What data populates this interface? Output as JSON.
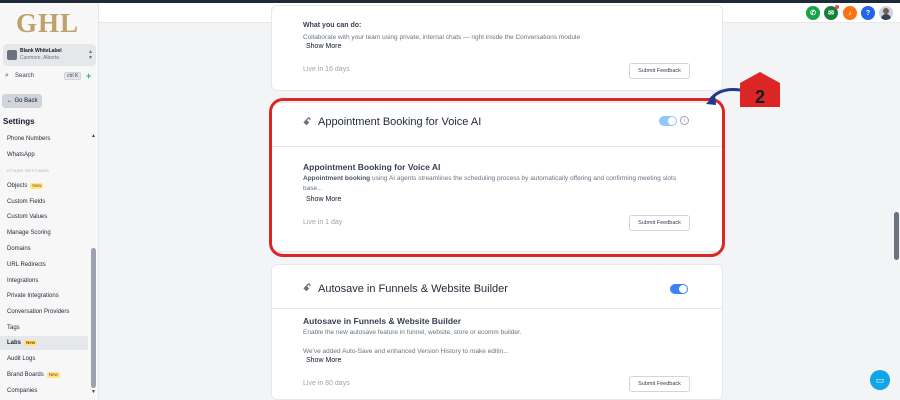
{
  "brand": {
    "logo_text": "GHL"
  },
  "location": {
    "name": "Blank WhiteLabel",
    "sub": "Canmore, Alberta"
  },
  "search": {
    "label": "Search",
    "shortcut": "ctrl K"
  },
  "sidebar": {
    "back_label": "Go Back",
    "heading": "Settings",
    "items": [
      {
        "label": "Phone Numbers"
      },
      {
        "label": "WhatsApp"
      },
      {
        "label": "OTHER SETTINGS"
      },
      {
        "label": "Objects",
        "badge": "New"
      },
      {
        "label": "Custom Fields"
      },
      {
        "label": "Custom Values"
      },
      {
        "label": "Manage Scoring"
      },
      {
        "label": "Domains"
      },
      {
        "label": "URL Redirects"
      },
      {
        "label": "Integrations"
      },
      {
        "label": "Private Integrations"
      },
      {
        "label": "Conversation Providers"
      },
      {
        "label": "Tags"
      },
      {
        "label": "Labs",
        "badge": "New"
      },
      {
        "label": "Audit Logs"
      },
      {
        "label": "Brand Boards",
        "badge": "New"
      },
      {
        "label": "Companies"
      }
    ]
  },
  "header": {
    "icons": [
      "phone-icon",
      "megaphone-icon",
      "bell-icon",
      "help-icon",
      "avatar"
    ]
  },
  "cards": [
    {
      "what_label": "What you can do:",
      "description": "Collaborate with your team using private, internal chats — right inside the Conversations module",
      "show_more": "Show More",
      "live": "Live in 16 days",
      "feedback": "Submit Feedback"
    },
    {
      "title": "Appointment Booking for Voice AI",
      "subtitle": "Appointment Booking for Voice AI",
      "desc_bold": "Appointment booking",
      "description": " using AI agents streamlines the scheduling process by automatically offering and confirming meeting slots base...",
      "show_more": "Show More",
      "live": "Live in 1 day",
      "feedback": "Submit Feedback",
      "enabled": true
    },
    {
      "title": "Autosave in Funnels & Website Builder",
      "subtitle": "Autosave in Funnels & Website Builder",
      "description": "Enable the new autosave feature in funnel, website, store or ecomm builder.",
      "description2": "We've added Auto-Save and enhanced Version History to make editin...",
      "show_more": "Show More",
      "live": "Live in 80 days",
      "feedback": "Submit Feedback",
      "enabled": true
    }
  ],
  "annotation": {
    "step": "2"
  },
  "colors": {
    "highlight": "#dc2626",
    "accent": "#3b82f6",
    "annotation_arrow": "#1e3a8a"
  }
}
